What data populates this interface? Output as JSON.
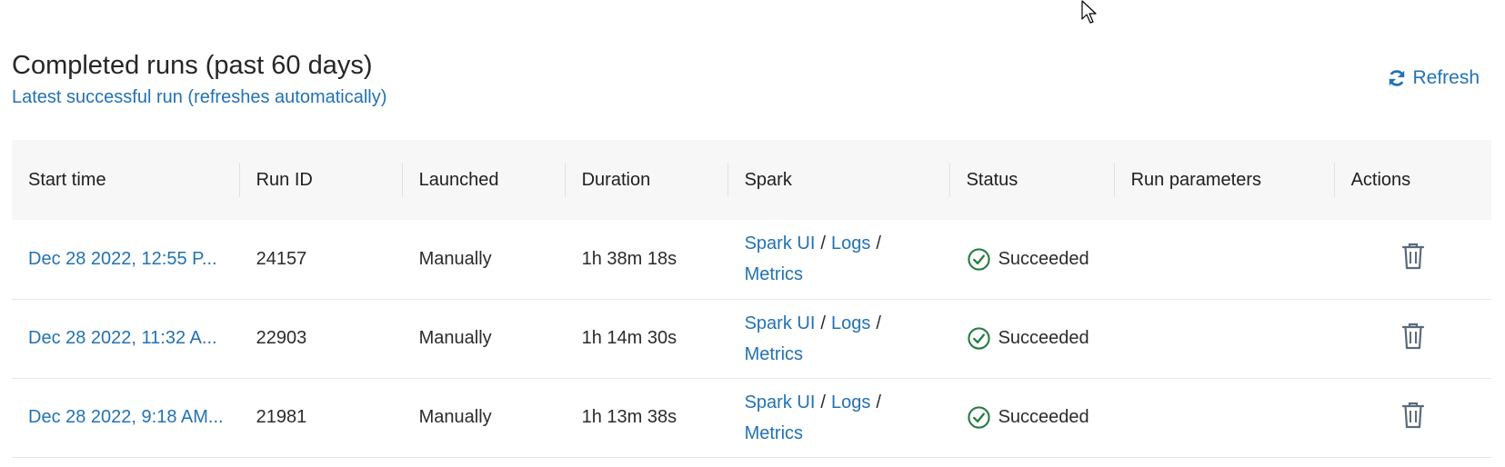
{
  "header": {
    "title": "Completed runs (past 60 days)",
    "subtitle_link": "Latest successful run (refreshes automatically)",
    "refresh_label": "Refresh"
  },
  "table": {
    "columns": [
      "Start time",
      "Run ID",
      "Launched",
      "Duration",
      "Spark",
      "Status",
      "Run parameters",
      "Actions"
    ],
    "rows": [
      {
        "start_time": "Dec 28 2022, 12:55 P...",
        "run_id": "24157",
        "launched": "Manually",
        "duration": "1h 38m 18s",
        "spark_ui": "Spark UI",
        "logs": "Logs",
        "metrics": "Metrics",
        "status": "Succeeded",
        "run_parameters": ""
      },
      {
        "start_time": "Dec 28 2022, 11:32 A...",
        "run_id": "22903",
        "launched": "Manually",
        "duration": "1h 14m 30s",
        "spark_ui": "Spark UI",
        "logs": "Logs",
        "metrics": "Metrics",
        "status": "Succeeded",
        "run_parameters": ""
      },
      {
        "start_time": "Dec 28 2022, 9:18 AM...",
        "run_id": "21981",
        "launched": "Manually",
        "duration": "1h 13m 38s",
        "spark_ui": "Spark UI",
        "logs": "Logs",
        "metrics": "Metrics",
        "status": "Succeeded",
        "run_parameters": ""
      }
    ],
    "separator": "/"
  },
  "colors": {
    "link": "#2272b4",
    "success": "#277c43",
    "header_bg": "#f7f7f7"
  },
  "icons": {
    "refresh": "refresh-icon",
    "status": "check-circle-icon",
    "delete": "trash-icon",
    "cursor": "mouse-cursor-icon"
  }
}
